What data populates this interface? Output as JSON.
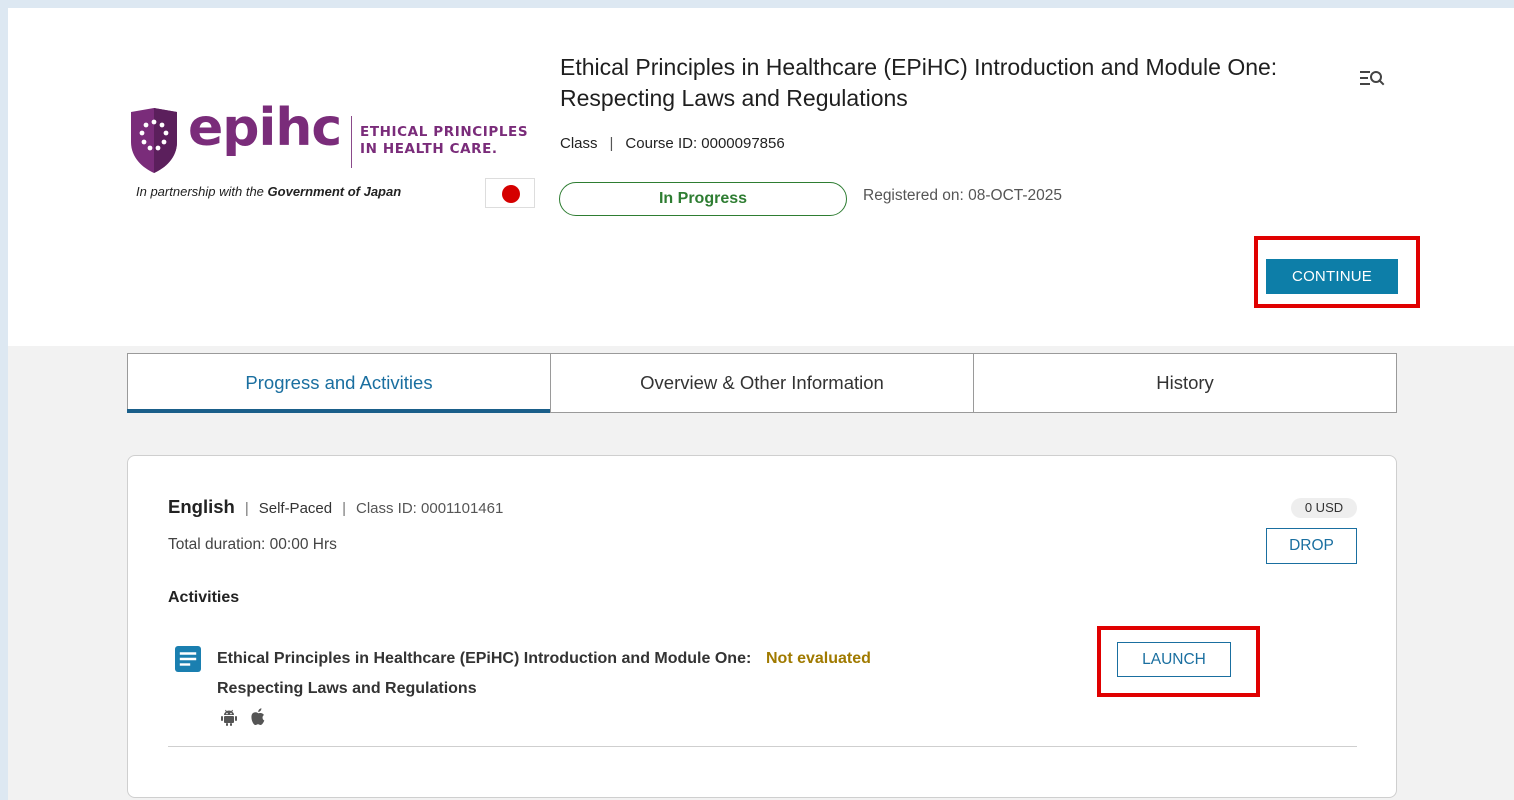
{
  "logo": {
    "wordmark": "epihc",
    "tagline_line1": "ETHICAL PRINCIPLES",
    "tagline_line2": "IN HEALTH CARE.",
    "partner_prefix": "In partnership with the ",
    "partner_name": "Government of Japan",
    "brand_color": "#7a2c7a"
  },
  "course": {
    "title": "Ethical Principles in Healthcare (EPiHC) Introduction and Module One: Respecting Laws and Regulations",
    "type": "Class",
    "separator": "|",
    "course_id": "Course ID: 0000097856",
    "status": "In Progress",
    "registered": "Registered on: 08-OCT-2025",
    "continue_label": "CONTINUE"
  },
  "header_icons": {
    "search_menu": "search-menu-icon"
  },
  "tabs": [
    {
      "label": "Progress and Activities",
      "active": true
    },
    {
      "label": "Overview & Other Information",
      "active": false
    },
    {
      "label": "History",
      "active": false
    }
  ],
  "class_card": {
    "language": "English",
    "separator": "|",
    "pace": "Self-Paced",
    "class_id": "Class ID: 0001101461",
    "duration": "Total duration: 00:00 Hrs",
    "price": "0 USD",
    "drop_label": "DROP",
    "activities_label": "Activities",
    "activity": {
      "icon": "document-icon",
      "title": "Ethical Principles in Healthcare (EPiHC) Introduction and Module One: Respecting Laws and Regulations",
      "evaluation": "Not evaluated",
      "launch_label": "LAUNCH",
      "platforms": [
        "android-icon",
        "apple-icon"
      ]
    }
  },
  "colors": {
    "accent": "#0d7ea8",
    "status_green": "#2e7d32",
    "eval_amber": "#a07a00",
    "highlight_red": "#e00000"
  }
}
